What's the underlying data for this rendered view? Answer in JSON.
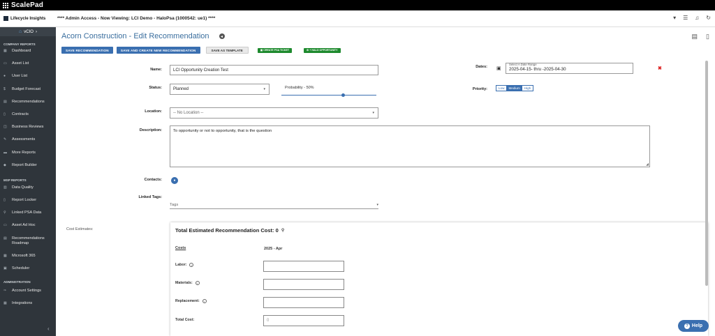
{
  "topbar": {
    "brand": "ScalePad"
  },
  "header": {
    "logo_text": "Lifecycle Insights",
    "banner": "**** Admin Access - Now Viewing: LCI Demo - HaloPsa (1000542: ue1) ****",
    "icons": [
      "caret-down-icon",
      "list-icon",
      "bell-icon",
      "refresh-icon"
    ]
  },
  "sidebar": {
    "vcio_label": "vCIO",
    "sections": [
      {
        "title": "COMPANY REPORTS",
        "items": [
          "Dashboard",
          "Asset List",
          "User List",
          "Budget Forecast",
          "Recommendations",
          "Contracts",
          "Business Reviews",
          "Assessments",
          "More Reports",
          "Report Builder"
        ]
      },
      {
        "title": "MSP REPORTS",
        "items": [
          "Data Quality",
          "Report Locker",
          "Linked PSA Data",
          "Asset Ad Hoc",
          "Recommendations Roadmap",
          "Microsoft 365",
          "Scheduler"
        ]
      },
      {
        "title": "ADMINISTRATION",
        "items": [
          "Account Settings",
          "Integrations"
        ]
      }
    ]
  },
  "page": {
    "title": "Acorn Construction - Edit Recommendation"
  },
  "buttons": {
    "save": "SAVE RECOMMENDATION",
    "save_new": "SAVE AND CREATE NEW RECOMMENDATION",
    "save_template": "SAVE AS TEMPLATE",
    "psa_ticket": "CREATE PSA TICKET",
    "halo_opportunity": "+ HALO OPPORTUNITY"
  },
  "form": {
    "name_label": "Name:",
    "name_value": "LCI Opportunity Creation Test",
    "status_label": "Status:",
    "status_value": "Planned",
    "probability_label": "Probability - 50%",
    "probability": 0.5,
    "location_label": "Location:",
    "location_value": "-- No Location --",
    "description_label": "Description:",
    "description_value": "To opportunity or not to opportunity, that is the question",
    "contacts_label": "Contacts:",
    "tags_label": "Linked Tags:",
    "tags_placeholder": "Tags",
    "dates_label": "Dates:",
    "date_range_hint": "Select A Date Range",
    "date_range_value": "2025-04-15- thru -2025-04-30",
    "priority_label": "Priority:",
    "priority_options": [
      "Low",
      "Medium",
      "High"
    ],
    "priority_selected": "Medium"
  },
  "cost": {
    "section_label": "Cost Estimates:",
    "title": "Total Estimated Recommendation Cost: 0",
    "costs_header": "Costs",
    "period": "2025 - Apr",
    "labor_label": "Labor:",
    "materials_label": "Materials:",
    "replacement_label": "Replacement:",
    "total_label": "Total Cost:",
    "total_value": "0"
  },
  "help": {
    "label": "Help"
  },
  "colors": {
    "accent": "#3a6fb0",
    "sidebar": "#2f353b",
    "green": "#1e8a2e",
    "title": "#3a6e9e"
  }
}
